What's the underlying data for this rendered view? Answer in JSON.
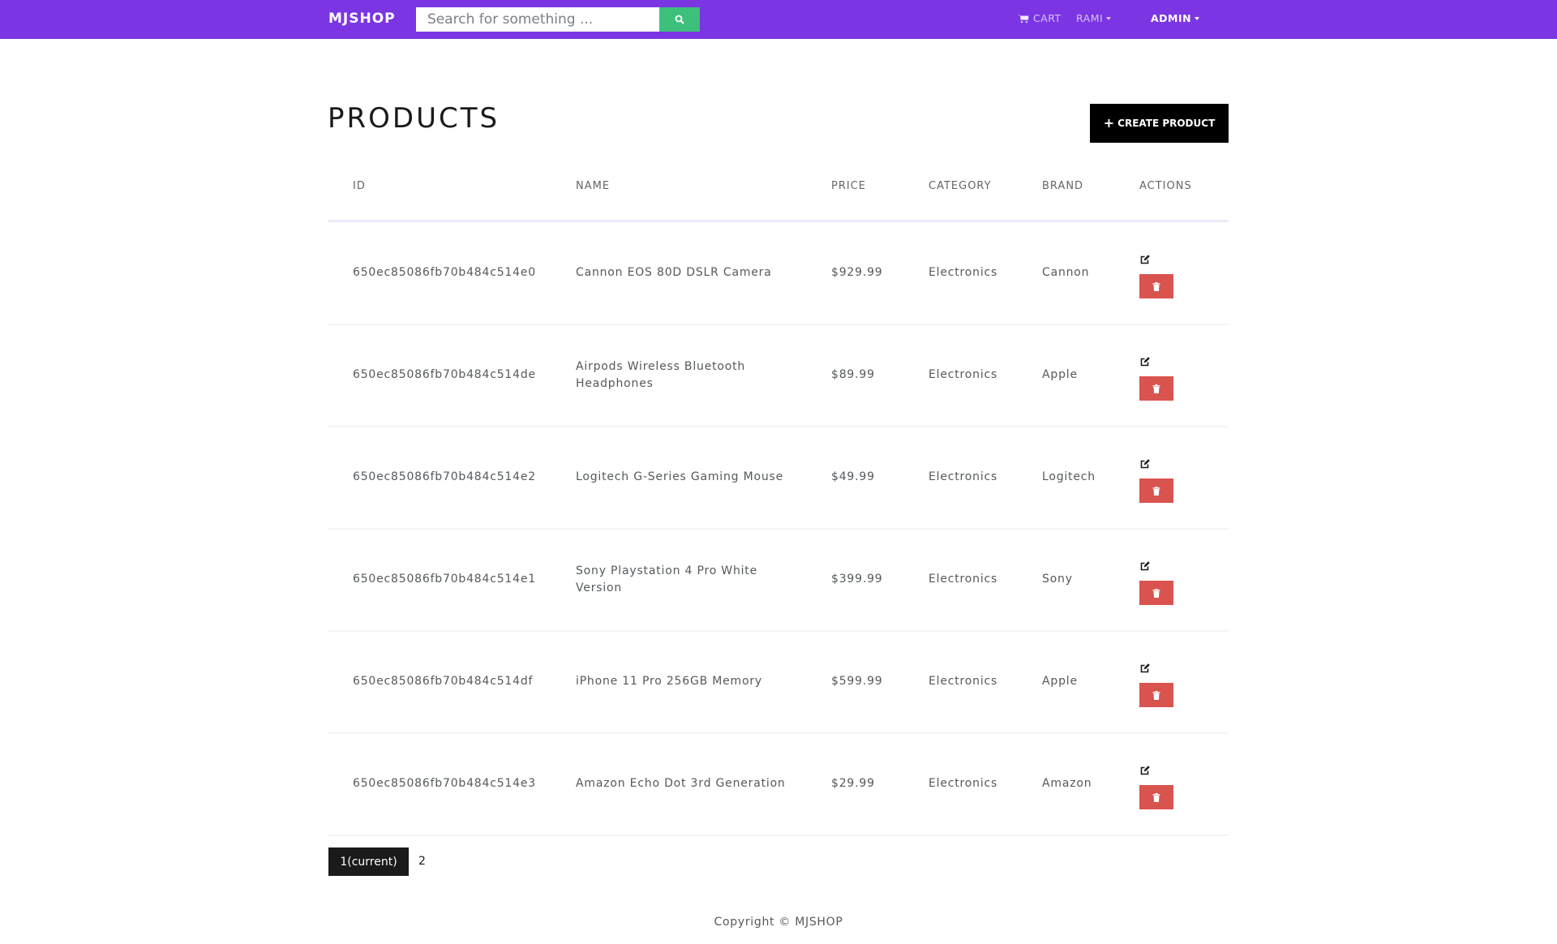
{
  "nav": {
    "brand": "MJSHOP",
    "search_placeholder": "Search for something ...",
    "cart_label": "CART",
    "user_label": "RAMI",
    "admin_label": "ADMIN"
  },
  "page": {
    "title": "PRODUCTS",
    "create_button": "CREATE PRODUCT"
  },
  "table": {
    "headers": [
      "ID",
      "NAME",
      "PRICE",
      "CATEGORY",
      "BRAND",
      "ACTIONS"
    ],
    "rows": [
      {
        "id": "650ec85086fb70b484c514e0",
        "name": "Cannon EOS 80D DSLR Camera",
        "price": "$929.99",
        "category": "Electronics",
        "brand": "Cannon"
      },
      {
        "id": "650ec85086fb70b484c514de",
        "name": "Airpods Wireless Bluetooth Headphones",
        "price": "$89.99",
        "category": "Electronics",
        "brand": "Apple"
      },
      {
        "id": "650ec85086fb70b484c514e2",
        "name": "Logitech G-Series Gaming Mouse",
        "price": "$49.99",
        "category": "Electronics",
        "brand": "Logitech"
      },
      {
        "id": "650ec85086fb70b484c514e1",
        "name": "Sony Playstation 4 Pro White Version",
        "price": "$399.99",
        "category": "Electronics",
        "brand": "Sony"
      },
      {
        "id": "650ec85086fb70b484c514df",
        "name": "iPhone 11 Pro 256GB Memory",
        "price": "$599.99",
        "category": "Electronics",
        "brand": "Apple"
      },
      {
        "id": "650ec85086fb70b484c514e3",
        "name": "Amazon Echo Dot 3rd Generation",
        "price": "$29.99",
        "category": "Electronics",
        "brand": "Amazon"
      }
    ]
  },
  "pagination": {
    "current_label": "1(current)",
    "next_page_label": "2"
  },
  "footer": {
    "copyright": "Copyright © MJSHOP"
  },
  "colors": {
    "navbar": "#7b35e2",
    "search_button": "#3ec07d",
    "delete_button": "#d9534f",
    "primary_dark": "#000000"
  }
}
